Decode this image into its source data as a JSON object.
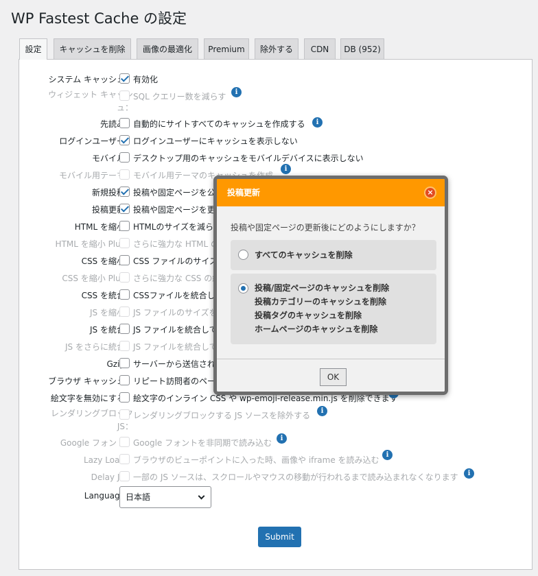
{
  "page": {
    "title": "WP Fastest Cache の設定"
  },
  "tabs": [
    "設定",
    "キャッシュを削除",
    "画像の最適化",
    "Premium",
    "除外する",
    "CDN",
    "DB (952)"
  ],
  "rows": [
    {
      "label": "システム キャッシュ：",
      "text": "有効化",
      "checked": true,
      "disabled": false,
      "info": false
    },
    {
      "label": "ウィジェット キャッシュ：",
      "text": "SQL クエリー数を減らす",
      "checked": false,
      "disabled": true,
      "info": true
    },
    {
      "label": "先読み：",
      "text": "自動的にサイトすべてのキャッシュを作成する",
      "checked": false,
      "disabled": false,
      "info": true
    },
    {
      "label": "ログインユーザー：",
      "text": "ログインユーザーにキャッシュを表示しない",
      "checked": true,
      "disabled": false,
      "info": false
    },
    {
      "label": "モバイル：",
      "text": "デスクトップ用のキャッシュをモバイルデバイスに表示しない",
      "checked": false,
      "disabled": false,
      "info": false
    },
    {
      "label": "モバイル用テーマ：",
      "text": "モバイル用テーマのキャッシュを作成",
      "checked": false,
      "disabled": true,
      "info": true
    },
    {
      "label": "新規投稿：",
      "text": "投稿や固定ページを公",
      "checked": true,
      "disabled": false,
      "info": false
    },
    {
      "label": "投稿更新：",
      "text": "投稿や固定ページを更",
      "checked": true,
      "disabled": false,
      "info": false
    },
    {
      "label": "HTML を縮小：",
      "text": "HTMLのサイズを減らす",
      "checked": false,
      "disabled": false,
      "info": false
    },
    {
      "label": "HTML を縮小 Plus：",
      "text": "さらに強力な HTML の",
      "checked": false,
      "disabled": true,
      "info": false
    },
    {
      "label": "CSS を縮小：",
      "text": "CSS ファイルのサイズ",
      "checked": false,
      "disabled": false,
      "info": false
    },
    {
      "label": "CSS を縮小 Plus：",
      "text": "さらに強力な CSS の縮",
      "checked": false,
      "disabled": true,
      "info": false
    },
    {
      "label": "CSS を統合：",
      "text": "CSSファイルを統合して",
      "checked": false,
      "disabled": false,
      "info": false
    },
    {
      "label": "JS を縮小：",
      "text": "JS ファイルのサイズを",
      "checked": false,
      "disabled": true,
      "info": false
    },
    {
      "label": "JS を統合：",
      "text": "JS ファイルを統合して",
      "checked": false,
      "disabled": false,
      "info": false
    },
    {
      "label": "JS をさらに統合：",
      "text": "JS ファイルを統合して",
      "checked": false,
      "disabled": true,
      "info": false
    },
    {
      "label": "Gzip：",
      "text": "サーバーから送信され",
      "checked": false,
      "disabled": false,
      "info": false
    },
    {
      "label": "ブラウザ キャッシュ：",
      "text": "リピート訪問者のペー",
      "checked": false,
      "disabled": false,
      "info": false
    },
    {
      "label": "絵文字を無効にする：",
      "text": "絵文字のインライン CSS や wp-emoji-release.min.js を削除できます",
      "checked": false,
      "disabled": false,
      "info": true
    },
    {
      "label": "レンダリングブロック JS：",
      "text": "レンダリングブロックする JS ソースを除外する",
      "checked": false,
      "disabled": true,
      "info": true
    },
    {
      "label": "Google フォント：",
      "text": "Google フォントを非同期で読み込む",
      "checked": false,
      "disabled": true,
      "info": true
    },
    {
      "label": "Lazy Load：",
      "text": "ブラウザのビューポイントに入った時、画像や iframe を読み込む",
      "checked": false,
      "disabled": true,
      "info": true
    },
    {
      "label": "Delay JS：",
      "text": "一部の JS ソースは、スクロールやマウスの移動が行われるまで読み込まれなくなります",
      "checked": false,
      "disabled": true,
      "info": true
    }
  ],
  "language": {
    "label": "Language：",
    "value": "日本語"
  },
  "submit_label": "Submit",
  "modal": {
    "title": "投稿更新",
    "close": "×",
    "question": "投稿や固定ページの更新後にどのようにしますか？",
    "option1": "すべてのキャッシュを削除",
    "option2_lines": [
      "投稿/固定ページのキャッシュを削除",
      "投稿カテゴリーのキャッシュを削除",
      "投稿タグのキャッシュを削除",
      "ホームページのキャッシュを削除"
    ],
    "selected_option": 2,
    "ok": "OK"
  },
  "colors": {
    "accent": "#2271b1",
    "modal_header": "#ff9800",
    "disabled_text": "#a7aaad"
  }
}
